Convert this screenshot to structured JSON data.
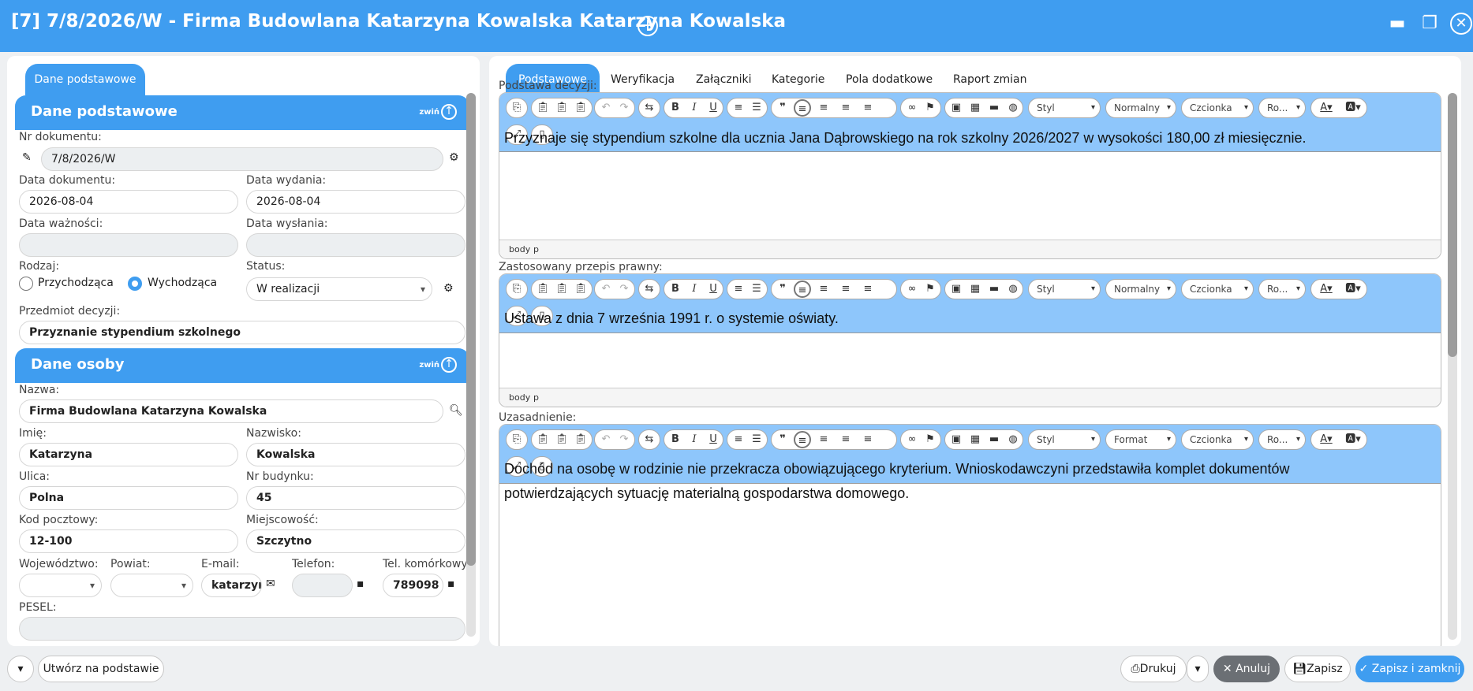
{
  "window": {
    "title": "[7] 7/8/2026/W - Firma Budowlana Katarzyna Kowalska Katarzyna Kowalska"
  },
  "left": {
    "tab": "Dane podstawowe",
    "section1": {
      "title": "Dane podstawowe",
      "collapse": "zwiń"
    },
    "nr_dokumentu": {
      "label": "Nr dokumentu:",
      "value": "7/8/2026/W"
    },
    "data_dokumentu": {
      "label": "Data dokumentu:",
      "value": "2026-08-04"
    },
    "data_wydania": {
      "label": "Data wydania:",
      "value": "2026-08-04"
    },
    "data_waznosci": {
      "label": "Data ważności:",
      "value": ""
    },
    "data_wyslania": {
      "label": "Data wysłania:",
      "value": ""
    },
    "rodzaj": {
      "label": "Rodzaj:",
      "opt1": "Przychodząca",
      "opt2": "Wychodząca",
      "selected": "Wychodząca"
    },
    "status": {
      "label": "Status:",
      "value": "W realizacji"
    },
    "przedmiot": {
      "label": "Przedmiot decyzji:",
      "value": "Przyznanie stypendium szkolnego"
    },
    "section2": {
      "title": "Dane osoby",
      "collapse": "zwiń"
    },
    "nazwa": {
      "label": "Nazwa:",
      "value": "Firma Budowlana Katarzyna Kowalska"
    },
    "imie": {
      "label": "Imię:",
      "value": "Katarzyna"
    },
    "nazwisko": {
      "label": "Nazwisko:",
      "value": "Kowalska"
    },
    "ulica": {
      "label": "Ulica:",
      "value": "Polna"
    },
    "nr_budynku": {
      "label": "Nr budynku:",
      "value": "45"
    },
    "kod": {
      "label": "Kod pocztowy:",
      "value": "12-100"
    },
    "miejscowosc": {
      "label": "Miejscowość:",
      "value": "Szczytno"
    },
    "wojewodztwo": {
      "label": "Województwo:",
      "value": ""
    },
    "powiat": {
      "label": "Powiat:",
      "value": ""
    },
    "email": {
      "label": "E-mail:",
      "value": "katarzyı"
    },
    "telefon": {
      "label": "Telefon:",
      "value": ""
    },
    "tel_kom": {
      "label": "Tel. komórkowy:",
      "value": "789098"
    },
    "pesel": {
      "label": "PESEL:",
      "value": ""
    }
  },
  "right": {
    "tabs": [
      "Podstawowe",
      "Weryfikacja",
      "Załączniki",
      "Kategorie",
      "Pola dodatkowe",
      "Raport zmian"
    ],
    "active_tab": "Podstawowe",
    "fields": [
      {
        "title": "Podstawa decyzji:",
        "style": "Styl",
        "format": "Normalny",
        "font": "Czcionka",
        "size": "Ro...",
        "text1": "Przyznaje się stypendium szkolne dla ucznia Jana Dąbrowskiego na rok szkolny 2026/2027 w wysokości 180,00 zł miesięcznie.",
        "text2": "",
        "path1": "body",
        "path2": "p"
      },
      {
        "title": "Zastosowany przepis prawny:",
        "style": "Styl",
        "format": "Normalny",
        "font": "Czcionka",
        "size": "Ro...",
        "text1": "Ustawa z dnia 7 września 1991 r. o systemie oświaty.",
        "text2": "",
        "path1": "body",
        "path2": "p"
      },
      {
        "title": "Uzasadnienie:",
        "style": "Styl",
        "format": "Format",
        "font": "Czcionka",
        "size": "Ro...",
        "text1": "Dochód na osobę w rodzinie nie przekracza obowiązującego kryterium. Wnioskodawczyni przedstawiła komplet dokumentów",
        "text2": "potwierdzających sytuację materialną gospodarstwa domowego.",
        "path1": "",
        "path2": ""
      }
    ]
  },
  "footer": {
    "create": "Utwórz na podstawie",
    "print": "Drukuj",
    "cancel": "Anuluj",
    "save": "Zapisz",
    "save_close": "Zapisz i zamknij"
  },
  "colors": {
    "accent": "#3f9df0",
    "toolbar": "#8ec6fb",
    "cancel_bg": "#6b6f74"
  }
}
